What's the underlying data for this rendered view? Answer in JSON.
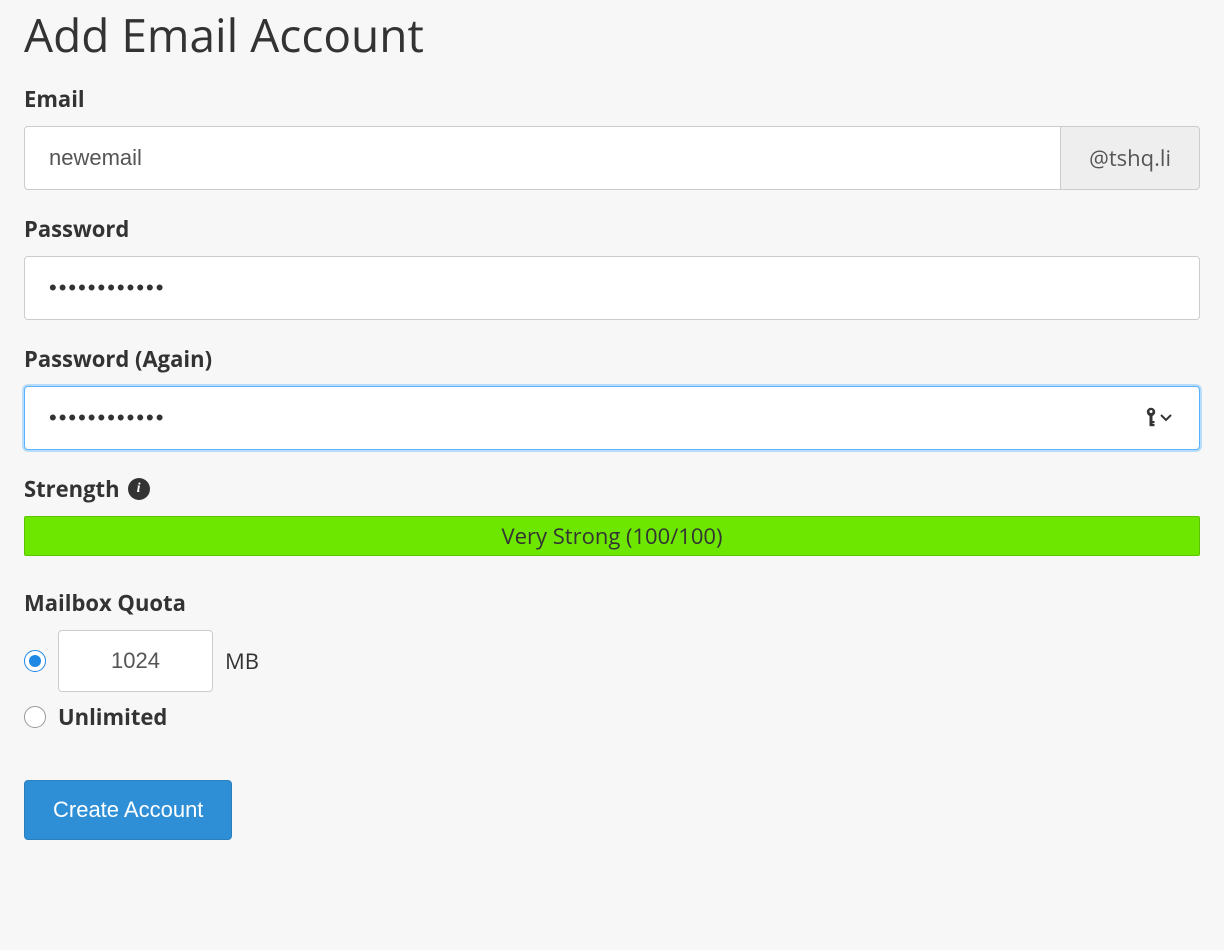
{
  "page": {
    "title": "Add Email Account"
  },
  "email": {
    "label": "Email",
    "value": "newemail",
    "domain": "@tshq.li"
  },
  "password": {
    "label": "Password",
    "value": "••••••••••••"
  },
  "password_confirm": {
    "label": "Password (Again)",
    "value": "••••••••••••"
  },
  "strength": {
    "label": "Strength",
    "status": "Very Strong (100/100)",
    "color": "#6de600"
  },
  "quota": {
    "label": "Mailbox Quota",
    "value": "1024",
    "unit": "MB",
    "unlimited_label": "Unlimited",
    "selected": "fixed"
  },
  "action": {
    "create_label": "Create Account"
  }
}
